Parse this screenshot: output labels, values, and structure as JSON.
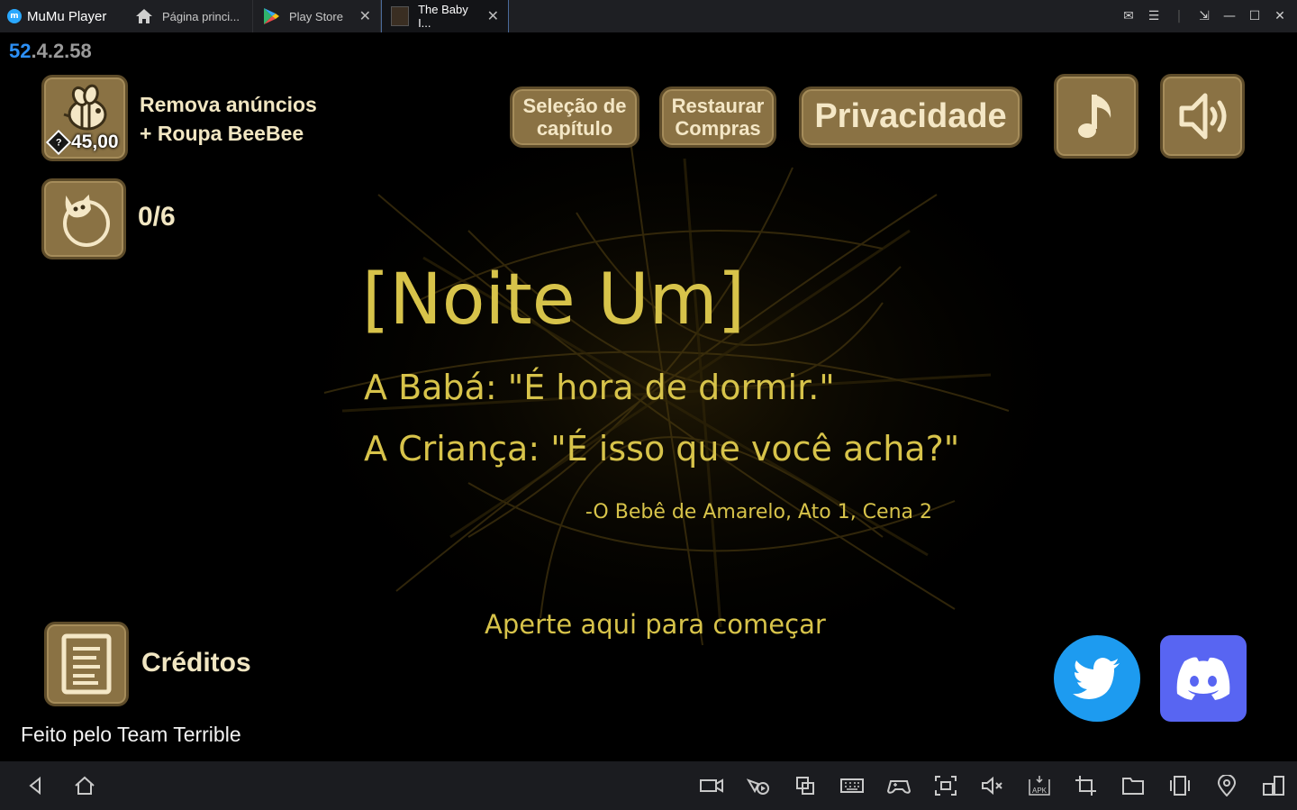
{
  "titlebar": {
    "app_name": "MuMu Player",
    "tabs": [
      {
        "label": "Página princi..."
      },
      {
        "label": "Play Store"
      },
      {
        "label": "The Baby I..."
      }
    ]
  },
  "game": {
    "version_prefix": "52",
    "version_rest": ".4.2.58",
    "remove_ads": {
      "line1": "Remova anúncios",
      "line2": "+ Roupa BeeBee",
      "price": "45,00"
    },
    "collectible_count": "0/6",
    "buttons": {
      "chapter_select": {
        "line1": "Seleção de",
        "line2": "capítulo"
      },
      "restore": {
        "line1": "Restaurar",
        "line2": "Compras"
      },
      "privacy": "Privacidade"
    },
    "title": "[Noite Um]",
    "quote_line1": "A Babá: \"É hora de dormir.\"",
    "quote_line2": "A Criança: \"É isso que você acha?\"",
    "attribution": "-O Bebê de Amarelo, Ato 1, Cena 2",
    "start_prompt": "Aperte aqui para começar",
    "credits_label": "Créditos",
    "made_by": "Feito pelo Team Terrible"
  },
  "colors": {
    "button_fill": "#8a7244",
    "button_border": "#5e4c2a",
    "text_yellow": "#d7c34a",
    "twitter_blue": "#1d9bf0",
    "discord_blurple": "#5865f2"
  },
  "icons": {
    "toolbar": [
      "back-icon",
      "home-icon",
      "record-video-icon",
      "operation-record-icon",
      "multi-instance-icon",
      "keyboard-icon",
      "gamepad-icon",
      "screenshot-icon",
      "volume-mute-icon",
      "install-apk-icon",
      "crop-icon",
      "folder-icon",
      "shake-icon",
      "location-icon",
      "split-screen-icon"
    ]
  }
}
